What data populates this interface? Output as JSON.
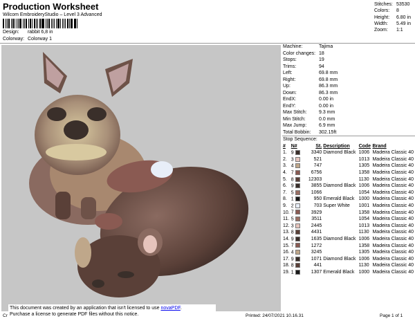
{
  "header": {
    "title": "Production Worksheet",
    "subtitle": "Wilcom EmbroideryStudio – Level 3 Advanced",
    "design_label": "Design:",
    "design_value": "rabbit 6,8 in",
    "colorway_label": "Colorway:",
    "colorway_value": "Colorway 1"
  },
  "stats": [
    {
      "label": "Stitches:",
      "value": "53530"
    },
    {
      "label": "Colors:",
      "value": "8"
    },
    {
      "label": "Height:",
      "value": "6.80 in"
    },
    {
      "label": "Width:",
      "value": "5.49 in"
    },
    {
      "label": "Zoom:",
      "value": "1:1"
    }
  ],
  "machine": [
    {
      "label": "Machine:",
      "value": "Tajima"
    },
    {
      "label": "Color changes:",
      "value": "18"
    },
    {
      "label": "Stops:",
      "value": "19"
    },
    {
      "label": "Trims:",
      "value": "94"
    },
    {
      "label": "Left:",
      "value": "69.8 mm"
    },
    {
      "label": "Right:",
      "value": "69.8 mm"
    },
    {
      "label": "Up:",
      "value": "86.3 mm"
    },
    {
      "label": "Down:",
      "value": "86.3 mm"
    },
    {
      "label": "EndX:",
      "value": "0.00 in"
    },
    {
      "label": "EndY:",
      "value": "0.00 in"
    },
    {
      "label": "Max Stitch:",
      "value": "9.3 mm"
    },
    {
      "label": "Min Stitch:",
      "value": "0.0 mm"
    },
    {
      "label": "Max Jump:",
      "value": "6.9 mm"
    },
    {
      "label": "Total Bobbin:",
      "value": "302.15ft"
    }
  ],
  "stop_sequence": {
    "title": "Stop Sequence:",
    "headers": {
      "num": "#",
      "n": "N#",
      "st": "St.",
      "desc": "Description",
      "code": "Code",
      "brand": "Brand"
    },
    "rows": [
      {
        "num": "1.",
        "n": "9",
        "color": "#3a2f2a",
        "st": "3340",
        "desc": "Diamond Black",
        "code": "1006",
        "brand": "Madeira Classic 40"
      },
      {
        "num": "2.",
        "n": "3",
        "color": "#e6c4bc",
        "st": "521",
        "desc": "",
        "code": "1013",
        "brand": "Madeira Classic 40"
      },
      {
        "num": "3.",
        "n": "4",
        "color": "#bfa78a",
        "st": "747",
        "desc": "",
        "code": "1305",
        "brand": "Madeira Classic 40"
      },
      {
        "num": "4.",
        "n": "7",
        "color": "#8a5a52",
        "st": "6756",
        "desc": "",
        "code": "1358",
        "brand": "Madeira Classic 40"
      },
      {
        "num": "5.",
        "n": "8",
        "color": "#5a4038",
        "st": "12303",
        "desc": "",
        "code": "1130",
        "brand": "Madeira Classic 40"
      },
      {
        "num": "6.",
        "n": "9",
        "color": "#3a2f2a",
        "st": "3855",
        "desc": "Diamond Black",
        "code": "1006",
        "brand": "Madeira Classic 40"
      },
      {
        "num": "7.",
        "n": "5",
        "color": "#9a6e62",
        "st": "1066",
        "desc": "",
        "code": "1054",
        "brand": "Madeira Classic 40"
      },
      {
        "num": "8.",
        "n": "1",
        "color": "#1a1a1a",
        "st": "950",
        "desc": "Emerald Black",
        "code": "1000",
        "brand": "Madeira Classic 40"
      },
      {
        "num": "9.",
        "n": "2",
        "color": "#e8eef8",
        "st": "703",
        "desc": "Super White",
        "code": "1001",
        "brand": "Madeira Classic 40"
      },
      {
        "num": "10.",
        "n": "7",
        "color": "#8a5a52",
        "st": "3929",
        "desc": "",
        "code": "1358",
        "brand": "Madeira Classic 40"
      },
      {
        "num": "11.",
        "n": "5",
        "color": "#9a6e62",
        "st": "3511",
        "desc": "",
        "code": "1054",
        "brand": "Madeira Classic 40"
      },
      {
        "num": "12.",
        "n": "3",
        "color": "#e6c4bc",
        "st": "2445",
        "desc": "",
        "code": "1013",
        "brand": "Madeira Classic 40"
      },
      {
        "num": "13.",
        "n": "8",
        "color": "#5a4038",
        "st": "4431",
        "desc": "",
        "code": "1130",
        "brand": "Madeira Classic 40"
      },
      {
        "num": "14.",
        "n": "9",
        "color": "#3a2f2a",
        "st": "1635",
        "desc": "Diamond Black",
        "code": "1006",
        "brand": "Madeira Classic 40"
      },
      {
        "num": "15.",
        "n": "7",
        "color": "#8a5a52",
        "st": "1272",
        "desc": "",
        "code": "1358",
        "brand": "Madeira Classic 40"
      },
      {
        "num": "16.",
        "n": "4",
        "color": "#bfa78a",
        "st": "3245",
        "desc": "",
        "code": "1305",
        "brand": "Madeira Classic 40"
      },
      {
        "num": "17.",
        "n": "9",
        "color": "#3a2f2a",
        "st": "1071",
        "desc": "Diamond Black",
        "code": "1006",
        "brand": "Madeira Classic 40"
      },
      {
        "num": "18.",
        "n": "8",
        "color": "#5a4038",
        "st": "441",
        "desc": "",
        "code": "1130",
        "brand": "Madeira Classic 40"
      },
      {
        "num": "19.",
        "n": "1",
        "color": "#1a1a1a",
        "st": "1307",
        "desc": "Emerald Black",
        "code": "1000",
        "brand": "Madeira Classic 40"
      }
    ]
  },
  "notice": {
    "line1_prefix": "This document was created by an application that isn't licensed to use ",
    "link": "novaPDF",
    "line1_suffix": ".",
    "line2": "Purchase a license to generate PDF files without this notice."
  },
  "footer": {
    "left": "Cr",
    "printed": "Printed: 24/07/2021 10.16.31",
    "page": "Page 1 of 1"
  }
}
